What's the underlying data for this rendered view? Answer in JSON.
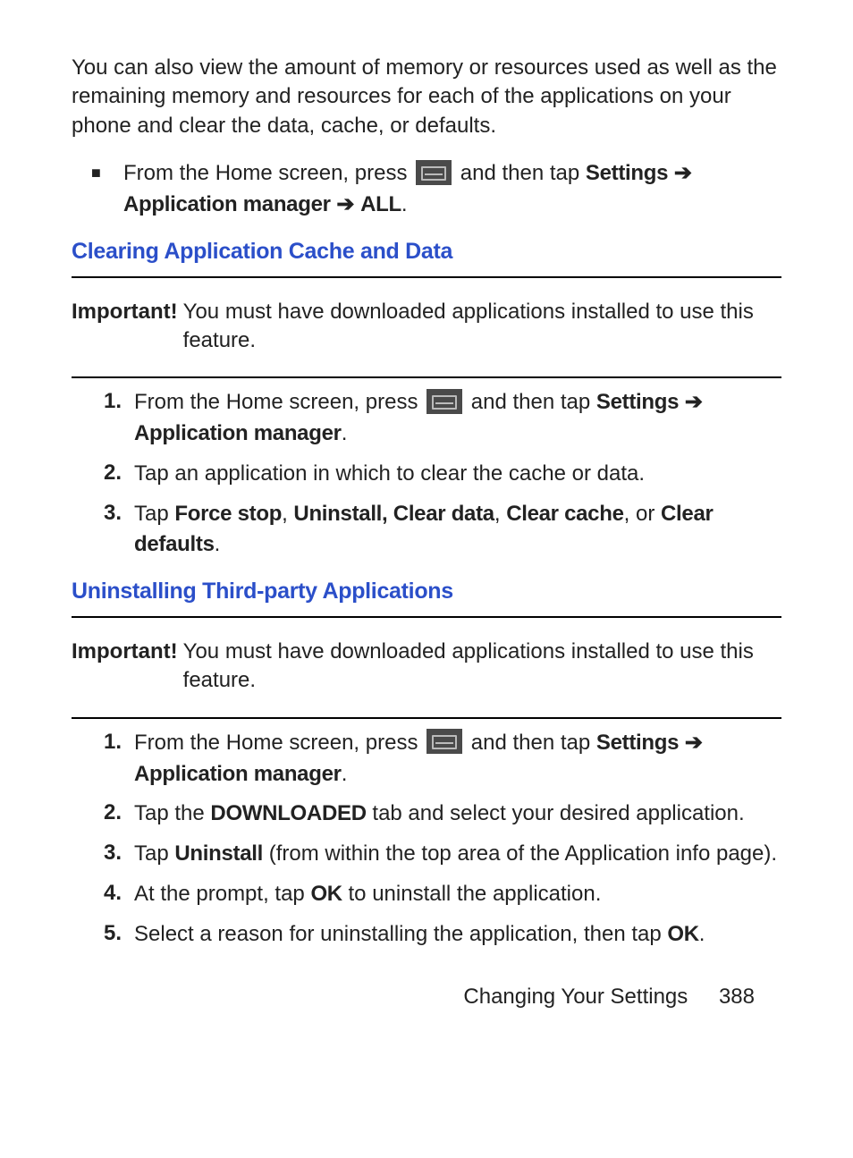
{
  "intro": "You can also view the amount of memory or resources used as well as the remaining memory and resources for each of the applications on your phone and clear the data, cache, or defaults.",
  "bullet1": {
    "pre": "From the Home screen, press ",
    "post": " and then tap ",
    "settings": "Settings",
    "arrow": "➔",
    "line2a": "Application manager",
    "line2arrow": " ➔ ",
    "line2b": "ALL",
    "period": "."
  },
  "heading1": "Clearing Application Cache and Data",
  "important1": {
    "label": "Important!",
    "text": "You must have downloaded applications installed to use this feature."
  },
  "listA": {
    "n1": "1.",
    "i1pre": "From the Home screen, press ",
    "i1post": " and then tap ",
    "i1settings": "Settings",
    "i1arrow": " ➔",
    "i1line2": "Application manager",
    "i1period": ".",
    "n2": "2.",
    "i2": "Tap an application in which to clear the cache or data.",
    "n3": "3.",
    "i3a": "Tap ",
    "i3b": "Force stop",
    "i3c": ", ",
    "i3d": "Uninstall, Clear data",
    "i3e": ", ",
    "i3f": "Clear cache",
    "i3g": ", or ",
    "i3h": "Clear defaults",
    "i3i": "."
  },
  "heading2": "Uninstalling Third-party Applications",
  "important2": {
    "label": "Important!",
    "text": "You must have downloaded applications installed to use this feature."
  },
  "listB": {
    "n1": "1.",
    "i1pre": "From the Home screen, press ",
    "i1post": " and then tap ",
    "i1settings": "Settings",
    "i1arrow": " ➔",
    "i1line2": "Application manager",
    "i1period": ".",
    "n2": "2.",
    "i2a": "Tap the ",
    "i2b": "DOWNLOADED",
    "i2c": " tab and select your desired application.",
    "n3": "3.",
    "i3a": "Tap ",
    "i3b": "Uninstall",
    "i3c": " (from within the top area of the Application info page).",
    "n4": "4.",
    "i4a": "At the prompt, tap ",
    "i4b": "OK",
    "i4c": " to uninstall the application.",
    "n5": "5.",
    "i5a": "Select a reason for uninstalling the application, then tap ",
    "i5b": "OK",
    "i5c": "."
  },
  "footer": {
    "section": "Changing Your Settings",
    "page": "388"
  }
}
